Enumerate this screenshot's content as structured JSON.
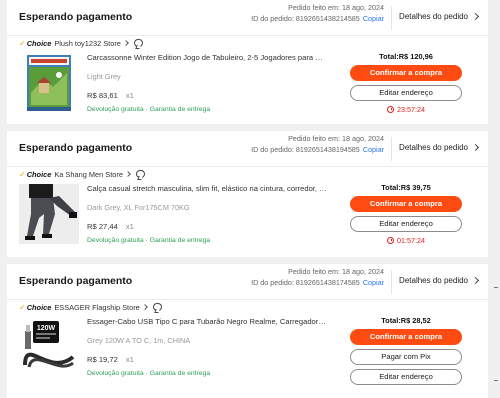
{
  "common": {
    "copy_label": "Copiar",
    "details_label": "Detalhes do pedido",
    "choice_label": "Choice",
    "confirm_label": "Confirmar a compra",
    "edit_address_label": "Editar endereço",
    "guarantee_label": "Devolução gratuita · Garantia de entrega",
    "accent_color": "#fd4b12",
    "timer_color": "#e02020",
    "guarantee_color": "#2e9e57"
  },
  "orders": [
    {
      "status": "Esperando pagamento",
      "date": "Pedido feito em: 18 ago, 2024",
      "order_id": "ID do pedido: 8192651438214585",
      "store": "Plush toy1232 Store",
      "title": "Carcassonne Winter Edition Jogo de Tabuleiro, 2-5 Jogadores para Família",
      "variant": "Light Grey",
      "price": "R$ 83,61",
      "qty": "x1",
      "total": "Total:R$ 120,96",
      "timer": "23:57:24",
      "thumb_icon": "board-game-box-image"
    },
    {
      "status": "Esperando pagamento",
      "date": "Pedido feito em: 18 ago, 2024",
      "order_id": "ID do pedido: 8192651438194585",
      "store": "Ka Shang Men Store",
      "title": "Calça casual stretch masculina, slim fit, elástico na cintura, corredor, clássica",
      "variant": "Dark Grey, XL For175CM 70KG",
      "price": "R$ 27,44",
      "qty": "x1",
      "total": "Total:R$ 39,75",
      "timer": "01:57:24",
      "thumb_icon": "pants-model-image"
    },
    {
      "status": "Esperando pagamento",
      "date": "Pedido feito em: 18 ago, 2024",
      "order_id": "ID do pedido: 8192651438174585",
      "store": "ESSAGER Flagship Store",
      "title": "Essager-Cabo USB Tipo C para Tubarão Negro Realme, Carregador de Celular",
      "variant": "Grey 120W A TO C, 1m, CHINA",
      "price": "R$ 19,72",
      "qty": "x1",
      "total": "Total:R$ 28,52",
      "pix_label": "Pagar com Pix",
      "thumb_icon": "usb-cable-image",
      "thumb_badge": "120W"
    }
  ]
}
